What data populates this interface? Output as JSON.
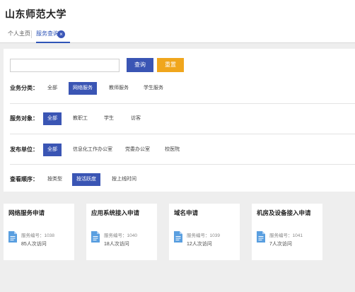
{
  "header": {
    "title": "山东师范大学"
  },
  "tabs": {
    "home": "个人主页",
    "services": "服务查询",
    "close": "×"
  },
  "search": {
    "placeholder": "",
    "query_label": "查询",
    "reset_label": "重置"
  },
  "filters": {
    "business": {
      "label": "业务分类：",
      "options": [
        "全部",
        "网络服务",
        "教师服务",
        "学生服务"
      ],
      "active": "网络服务"
    },
    "audience": {
      "label": "服务对象：",
      "options": [
        "全部",
        "教职工",
        "学生",
        "访客"
      ],
      "active": "全部"
    },
    "publisher": {
      "label": "发布单位：",
      "options": [
        "全部",
        "信息化工作办公室",
        "党委办公室",
        "校医院"
      ],
      "active": "全部"
    },
    "order": {
      "label": "查看顺序：",
      "options": [
        "按类型",
        "按活跃度",
        "按上线时间"
      ],
      "active": "按活跃度"
    }
  },
  "cards": [
    {
      "title": "网络服务申请",
      "number": "服务编号：1038",
      "visits": "85人次访问"
    },
    {
      "title": "应用系统接入申请",
      "number": "服务编号：1040",
      "visits": "18人次访问"
    },
    {
      "title": "域名申请",
      "number": "服务编号：1039",
      "visits": "12人次访问"
    },
    {
      "title": "机房及设备接入申请",
      "number": "服务编号：1041",
      "visits": "7人次访问"
    }
  ],
  "colors": {
    "primary": "#3a55b4",
    "reset": "#f0a61d",
    "icon": "#5a9fe0"
  },
  "icons": {
    "card": "document-icon",
    "close": "close-icon"
  }
}
